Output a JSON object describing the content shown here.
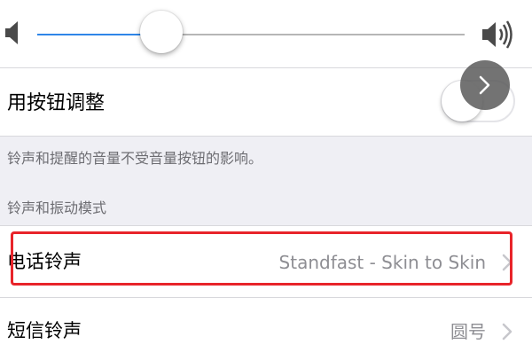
{
  "volume": {
    "level": 0.29,
    "accent_color": "#2f86e8",
    "icons": [
      "speaker-low-icon",
      "speaker-high-icon"
    ]
  },
  "button_adjust": {
    "label": "用按钮调整",
    "enabled": false
  },
  "info": {
    "note": "铃声和提醒的音量不受音量按钮的影响。",
    "section_header": "铃声和振动模式"
  },
  "list": {
    "ringtone": {
      "label": "电话铃声",
      "value": "Standfast - Skin to Skin"
    },
    "sms": {
      "label": "短信铃声",
      "value": "圆号"
    }
  },
  "annotation": {
    "highlight_color": "#e8242a"
  }
}
